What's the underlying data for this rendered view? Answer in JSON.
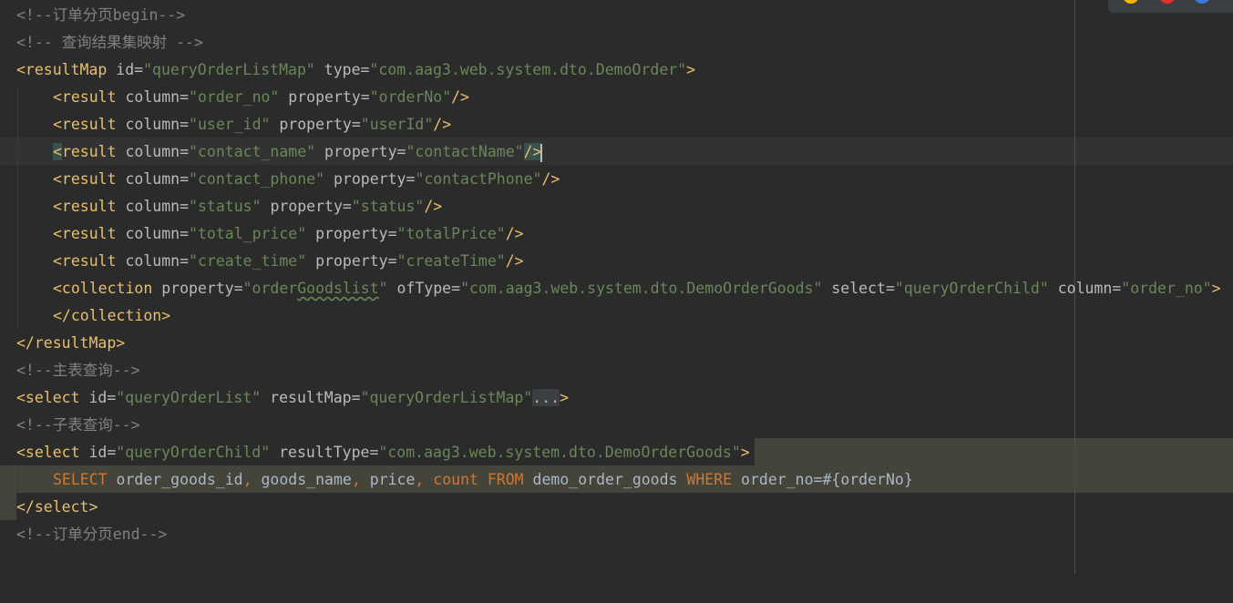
{
  "editor": {
    "lines": {
      "l1": {
        "comment": "<!--订单分页begin-->"
      },
      "l2": {
        "comment": "<!-- 查询结果集映射 -->"
      },
      "l3": {
        "open": "<resultMap",
        "a1": " id=",
        "v1": "\"queryOrderListMap\"",
        "a2": " type=",
        "v2": "\"com.aag3.web.system.dto.DemoOrder\"",
        "close": ">"
      },
      "l4": {
        "open": "<result",
        "a1": " column=",
        "v1": "\"order_no\"",
        "a2": " property=",
        "v2": "\"orderNo\"",
        "close": "/>"
      },
      "l5": {
        "open": "<result",
        "a1": " column=",
        "v1": "\"user_id\"",
        "a2": " property=",
        "v2": "\"userId\"",
        "close": "/>"
      },
      "l6": {
        "open_lt": "<",
        "open_name": "result",
        "a1": " column=",
        "v1": "\"contact_name\"",
        "a2": " property=",
        "v2": "\"contactName\"",
        "close": "/>"
      },
      "l7": {
        "open": "<result",
        "a1": " column=",
        "v1": "\"contact_phone\"",
        "a2": " property=",
        "v2": "\"contactPhone\"",
        "close": "/>"
      },
      "l8": {
        "open": "<result",
        "a1": " column=",
        "v1": "\"status\"",
        "a2": " property=",
        "v2": "\"status\"",
        "close": "/>"
      },
      "l9": {
        "open": "<result",
        "a1": " column=",
        "v1": "\"total_price\"",
        "a2": " property=",
        "v2": "\"totalPrice\"",
        "close": "/>"
      },
      "l10": {
        "open": "<result",
        "a1": " column=",
        "v1": "\"create_time\"",
        "a2": " property=",
        "v2": "\"createTime\"",
        "close": "/>"
      },
      "l11": {
        "open": "<collection",
        "a1": " property=",
        "v1a": "\"order",
        "v1b": "Goodslist",
        "v1c": "\"",
        "a2": " ofType=",
        "v2": "\"com.aag3.web.system.dto.DemoOrderGoods\"",
        "a3": " select=",
        "v3": "\"queryOrderChild\"",
        "a4": " column=",
        "v4": "\"order_no\"",
        "close": ">"
      },
      "l12": {
        "tag": "</collection>"
      },
      "l13": {
        "tag": "</resultMap>"
      },
      "l14": {
        "comment": "<!--主表查询-->"
      },
      "l15": {
        "open": "<select",
        "a1": " id=",
        "v1": "\"queryOrderList\"",
        "a2": " resultMap=",
        "v2": "\"queryOrderListMap\"",
        "fold": "...",
        "close": ">"
      },
      "l16": {
        "comment": "<!--子表查询-->"
      },
      "l17": {
        "open": "<select",
        "a1": " id=",
        "v1": "\"queryOrderChild\"",
        "a2": " resultType=",
        "v2": "\"com.aag3.web.system.dto.DemoOrderGoods\"",
        "close": ">"
      },
      "l18": {
        "kw1": "SELECT",
        "p1": " order_goods_id",
        "c1": ",",
        "p2": " goods_name",
        "c2": ",",
        "p3": " price",
        "c3": ",",
        "kw2": " count",
        "kw3": " FROM",
        "p4": " demo_order_goods",
        "kw4": " WHERE",
        "p5": " order_no=#{orderNo}"
      },
      "l19": {
        "tag": "</select>"
      },
      "l20": {
        "comment": "<!--订单分页end-->"
      }
    }
  },
  "colors": {
    "background": "#2b2b2b",
    "tag": "#e8bf6a",
    "attribute": "#bababa",
    "string": "#6a8759",
    "comment": "#808080",
    "keyword": "#cc7832",
    "text": "#a9b7c6"
  }
}
